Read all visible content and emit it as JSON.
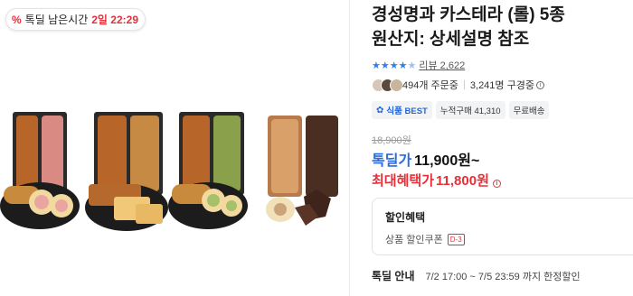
{
  "deal_badge": {
    "icon": "percent-icon",
    "label": "톡딜 남은시간",
    "time": "2일 22:29"
  },
  "product": {
    "title_line1": "경성명과 카스테라 (롤) 5종",
    "title_line2": "원산지: 상세설명 참조",
    "rating_stars": 4.5,
    "review_label": "리뷰 2,622",
    "orders_label": "494개 주문중",
    "viewers_label": "3,241명 구경중",
    "tags": [
      "식품 BEST",
      "누적구매 41,310",
      "무료배송"
    ],
    "original_price": "18,900원",
    "deal_price_label": "톡딜가",
    "deal_price": "11,900원~",
    "max_benefit_label": "최대혜택가",
    "max_benefit_price": "11,800원"
  },
  "coupon": {
    "heading": "할인혜택",
    "item": "상품 할인쿠폰",
    "dday": "D-3"
  },
  "deal_notice": {
    "label": "톡딜 안내",
    "text": "7/2 17:00 ~ 7/5 23:59 까지 한정할인"
  },
  "colors": {
    "accent_red": "#e5303a",
    "accent_blue": "#2b6be0",
    "star_blue": "#2f80ed"
  }
}
